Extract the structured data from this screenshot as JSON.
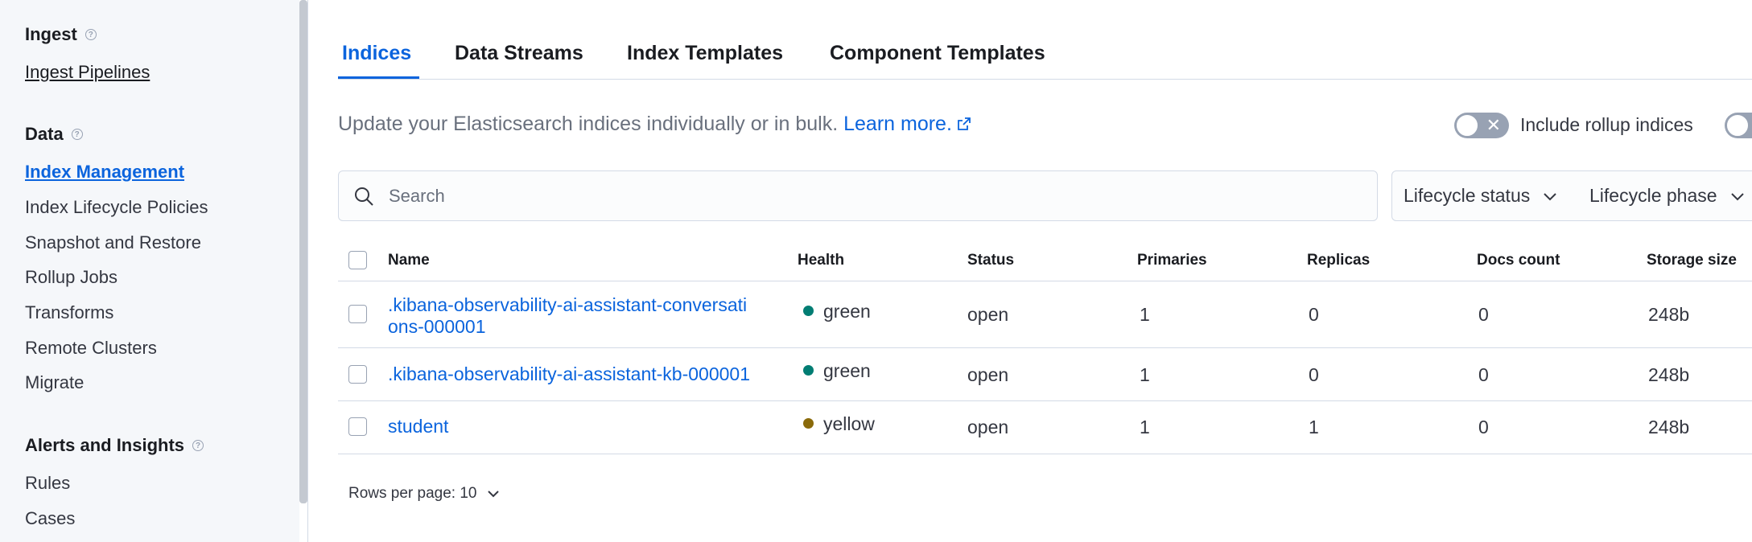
{
  "sidebar": {
    "groups": [
      {
        "title": "Ingest",
        "items": [
          "Ingest Pipelines"
        ]
      },
      {
        "title": "Data",
        "items": [
          "Index Management",
          "Index Lifecycle Policies",
          "Snapshot and Restore",
          "Rollup Jobs",
          "Transforms",
          "Remote Clusters",
          "Migrate"
        ]
      },
      {
        "title": "Alerts and Insights",
        "items": [
          "Rules",
          "Cases"
        ]
      }
    ],
    "active_item": "Index Management"
  },
  "tabs": [
    "Indices",
    "Data Streams",
    "Index Templates",
    "Component Templates"
  ],
  "active_tab": "Indices",
  "description": {
    "text": "Update your Elasticsearch indices individually or in bulk.",
    "link": "Learn more."
  },
  "toggles": {
    "rollup_label": "Include rollup indices",
    "rollup_on": false
  },
  "search": {
    "placeholder": "Search",
    "value": ""
  },
  "filters": [
    "Lifecycle status",
    "Lifecycle phase"
  ],
  "table": {
    "columns": [
      "Name",
      "Health",
      "Status",
      "Primaries",
      "Replicas",
      "Docs count",
      "Storage size"
    ],
    "rows": [
      {
        "name_line1": ".kibana-observability-ai-assistant-conversati",
        "name_line2": "ons-000001",
        "health": "green",
        "health_color": "#017d73",
        "status": "open",
        "primaries": "1",
        "replicas": "0",
        "docs": "0",
        "size": "248b"
      },
      {
        "name_line1": ".kibana-observability-ai-assistant-kb-000001",
        "name_line2": "",
        "health": "green",
        "health_color": "#017d73",
        "status": "open",
        "primaries": "1",
        "replicas": "0",
        "docs": "0",
        "size": "248b"
      },
      {
        "name_line1": "student",
        "name_line2": "",
        "health": "yellow",
        "health_color": "#8a6a0a",
        "status": "open",
        "primaries": "1",
        "replicas": "1",
        "docs": "0",
        "size": "248b"
      }
    ]
  },
  "pagination": {
    "rows_per_page": "Rows per page: 10"
  },
  "colors": {
    "accent": "#0b64dd",
    "sidebar_bg": "#f5f7fa",
    "border": "#d3dae6"
  }
}
